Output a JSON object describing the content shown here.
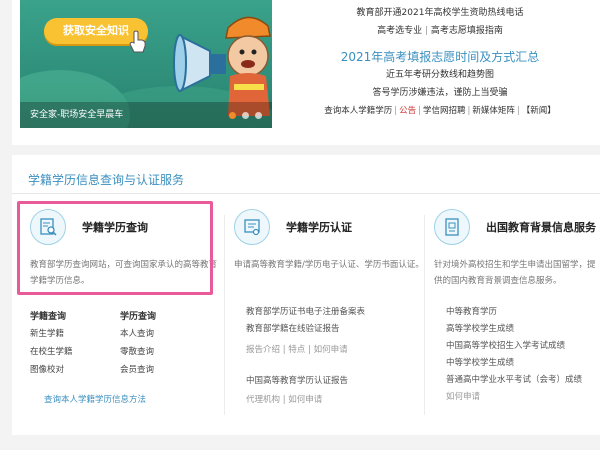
{
  "banner": {
    "button_label": "获取安全知识",
    "caption": "安全家-职场安全早晨车"
  },
  "news": {
    "line1": "教育部开通2021年高校学生资助热线电话",
    "line2_a": "高考选专业",
    "line2_b": "高考志愿填报指南",
    "headline": "2021年高考填报志愿时间及方式汇总",
    "line3": "近五年考研分数线和趋势图",
    "line4": "答号学历涉嫌违法，谨防上当受骗",
    "links": [
      "查询本人学籍学历",
      "公告",
      "学信网招聘",
      "新媒体矩阵",
      "【新闻】"
    ]
  },
  "section": {
    "title": "学籍学历信息查询与认证服务"
  },
  "cards": [
    {
      "title": "学籍学历查询",
      "desc": "教育部学历查询网站，可查询国家承认的高等教育学籍学历信息。",
      "col1_header": "学籍查询",
      "col2_header": "学历查询",
      "col1": [
        "新生学籍",
        "在校生学籍",
        "图像校对"
      ],
      "col2": [
        "本人查询",
        "零散查询",
        "会员查询"
      ],
      "footer_link": "查询本人学籍学历信息方法"
    },
    {
      "title": "学籍学历认证",
      "desc": "申请高等教育学籍/学历电子认证、学历书面认证。",
      "link1": "教育部学历证书电子注册备案表",
      "link2": "教育部学籍在线验证报告",
      "sub1": [
        "报告介绍",
        "特点",
        "如何申请"
      ],
      "link3": "中国高等教育学历认证报告",
      "sub2": [
        "代理机构",
        "如何申请"
      ]
    },
    {
      "title": "出国教育背景信息服务",
      "desc": "针对境外高校招生和学生申请出国留学，提供的国内教育背景调查信息服务。",
      "links": [
        "中等教育学历",
        "高等学校学生成绩",
        "中国高等学校招生入学考试成绩",
        "中等学校学生成绩",
        "普通高中学业水平考试（会考）成绩"
      ],
      "sub": "如何申请"
    }
  ],
  "colors": {
    "accent_blue": "#3a8fbf",
    "highlight_pink": "#e85a9a",
    "banner_green": "#2d8c78",
    "banner_button": "#f8c232"
  }
}
